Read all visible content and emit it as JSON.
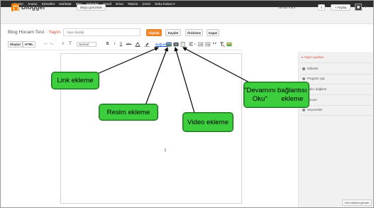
{
  "gbar": {
    "items": [
      "+Serdar",
      "Arama",
      "Görseller",
      "Haritalar",
      "Play",
      "Haberler",
      "Gmail",
      "Drive",
      "Takvim",
      "Çeviri",
      "Daha fazlası"
    ],
    "more_suffix": "▾"
  },
  "header": {
    "logo": "Blogger",
    "view_blog": "Blog'u görüntüle",
    "user": "Serdar Kara",
    "count": "0",
    "share": "+ Paylaş"
  },
  "post": {
    "blog_name": "Blog Hocam Test",
    "separator": " · ",
    "post_label": "Yayın",
    "title_placeholder": "Yayın başlığı",
    "publish": "Yayınla",
    "save": "Kaydet",
    "preview": "Önizleme",
    "close": "Kapat"
  },
  "toolbar": {
    "tab_compose": "Oluştur",
    "tab_html": "HTML",
    "font_label": "Normal",
    "link_label": "Bağlantı",
    "bold": "B",
    "italic": "I",
    "underline": "U",
    "strike": "ABC",
    "font_size": "T",
    "font_family": "F"
  },
  "sidebar": {
    "heading": "Yayın ayarları",
    "items": [
      "Etiketler",
      "Program yap",
      "Kalıcı bağlantı",
      "Konum",
      "Seçenekler"
    ],
    "feedback": "Geri bildirim gönder"
  },
  "callouts": {
    "link": "Link ekleme",
    "resim": "Resim ekleme",
    "video": "Video ekleme",
    "more_line1": "\"Devamını Oku\"",
    "more_line2": "bağlantısı ekleme"
  },
  "colors": {
    "gbar": "#2d2d2d",
    "blogger_orange": "#f57d00",
    "publish": "#f38b30",
    "post_accent": "#dd4b39",
    "callout_green": "#3dce3d",
    "link_blue": "#1155cc"
  }
}
